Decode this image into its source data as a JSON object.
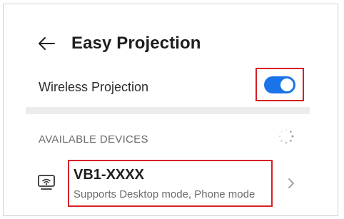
{
  "header": {
    "title": "Easy Projection",
    "back_icon": "arrow-left-icon"
  },
  "wireless": {
    "label": "Wireless Projection",
    "toggle_on": true,
    "accent": "#1a73e8"
  },
  "devices": {
    "section_header": "AVAILABLE DEVICES",
    "spinner_icon": "loading-spinner-icon",
    "items": [
      {
        "name": "VB1-XXXX",
        "subtitle": "Supports Desktop mode, Phone mode",
        "icon": "wireless-display-icon",
        "chevron": "chevron-right-icon"
      }
    ]
  },
  "highlight_color": "#d62027"
}
